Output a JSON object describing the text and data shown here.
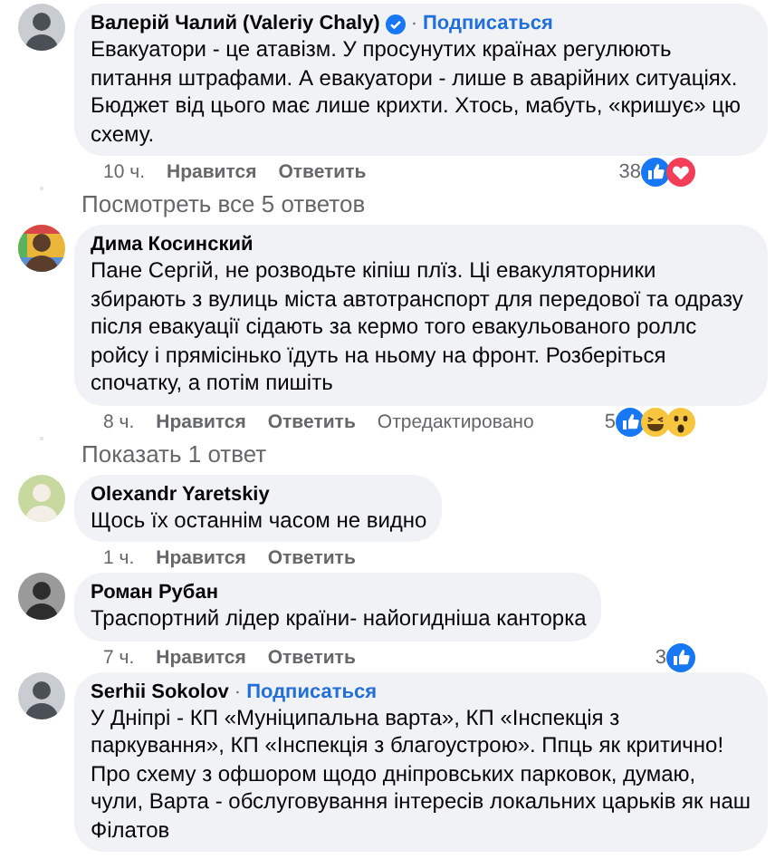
{
  "comments": [
    {
      "author": "Валерій Чалий (Valeriy Chaly)",
      "verified": true,
      "separator": "·",
      "subscribe": "Подписаться",
      "text": "Евакуатори - це атавізм. У просунутих країнах регулюють питання штрафами. А евакуатори - лише в аварійних ситуаціях. Бюджет від цього має лише крихти. Хтось, мабуть, «кришує» цю схему.",
      "time": "10 ч.",
      "like": "Нравится",
      "reply": "Ответить",
      "reaction_count": "38",
      "reactions": [
        {
          "kind": "like"
        },
        {
          "kind": "love"
        }
      ],
      "more_replies": "Посмотреть все 5 ответов"
    },
    {
      "author": "Дима Косинский",
      "verified": false,
      "text": "Пане Сергій, не розводьте кіпіш плїз. Ці евакуляторники збирають з вулиць міста автотранспорт для передової та одразу після евакуації сідають за кермо того евакульованого роллс ройсу і прямісінько їдуть на ньому на фронт. Розберіться спочатку, а потім пишіть",
      "time": "8 ч.",
      "like": "Нравится",
      "reply": "Ответить",
      "edited": "Отредактировано",
      "reaction_count": "5",
      "reactions": [
        {
          "kind": "like"
        },
        {
          "kind": "haha"
        },
        {
          "kind": "wow"
        }
      ],
      "more_replies": "Показать 1 ответ"
    },
    {
      "author": "Olexandr Yaretskiy",
      "verified": false,
      "text": "Щось їх останнім часом не видно",
      "time": "1 ч.",
      "like": "Нравится",
      "reply": "Ответить"
    },
    {
      "author": "Роман Рубан",
      "verified": false,
      "text": "Траспортний лідер країни- найогиднiша канторка",
      "time": "7 ч.",
      "like": "Нравится",
      "reply": "Ответить",
      "reaction_count": "3",
      "reactions": [
        {
          "kind": "like"
        }
      ]
    },
    {
      "author": "Serhii Sokolov",
      "verified": false,
      "separator": "·",
      "subscribe": "Подписаться",
      "text": "У Дніпрі - КП «Муніципальна варта», КП «Інспекція з паркування», КП «Інспекція з благоустрою». Ппць як критично! Про схему з офшором щодо дніпровських парковок, думаю, чули, Варта - обслуговування інтересів локальних царьків як наш Філатов"
    }
  ]
}
